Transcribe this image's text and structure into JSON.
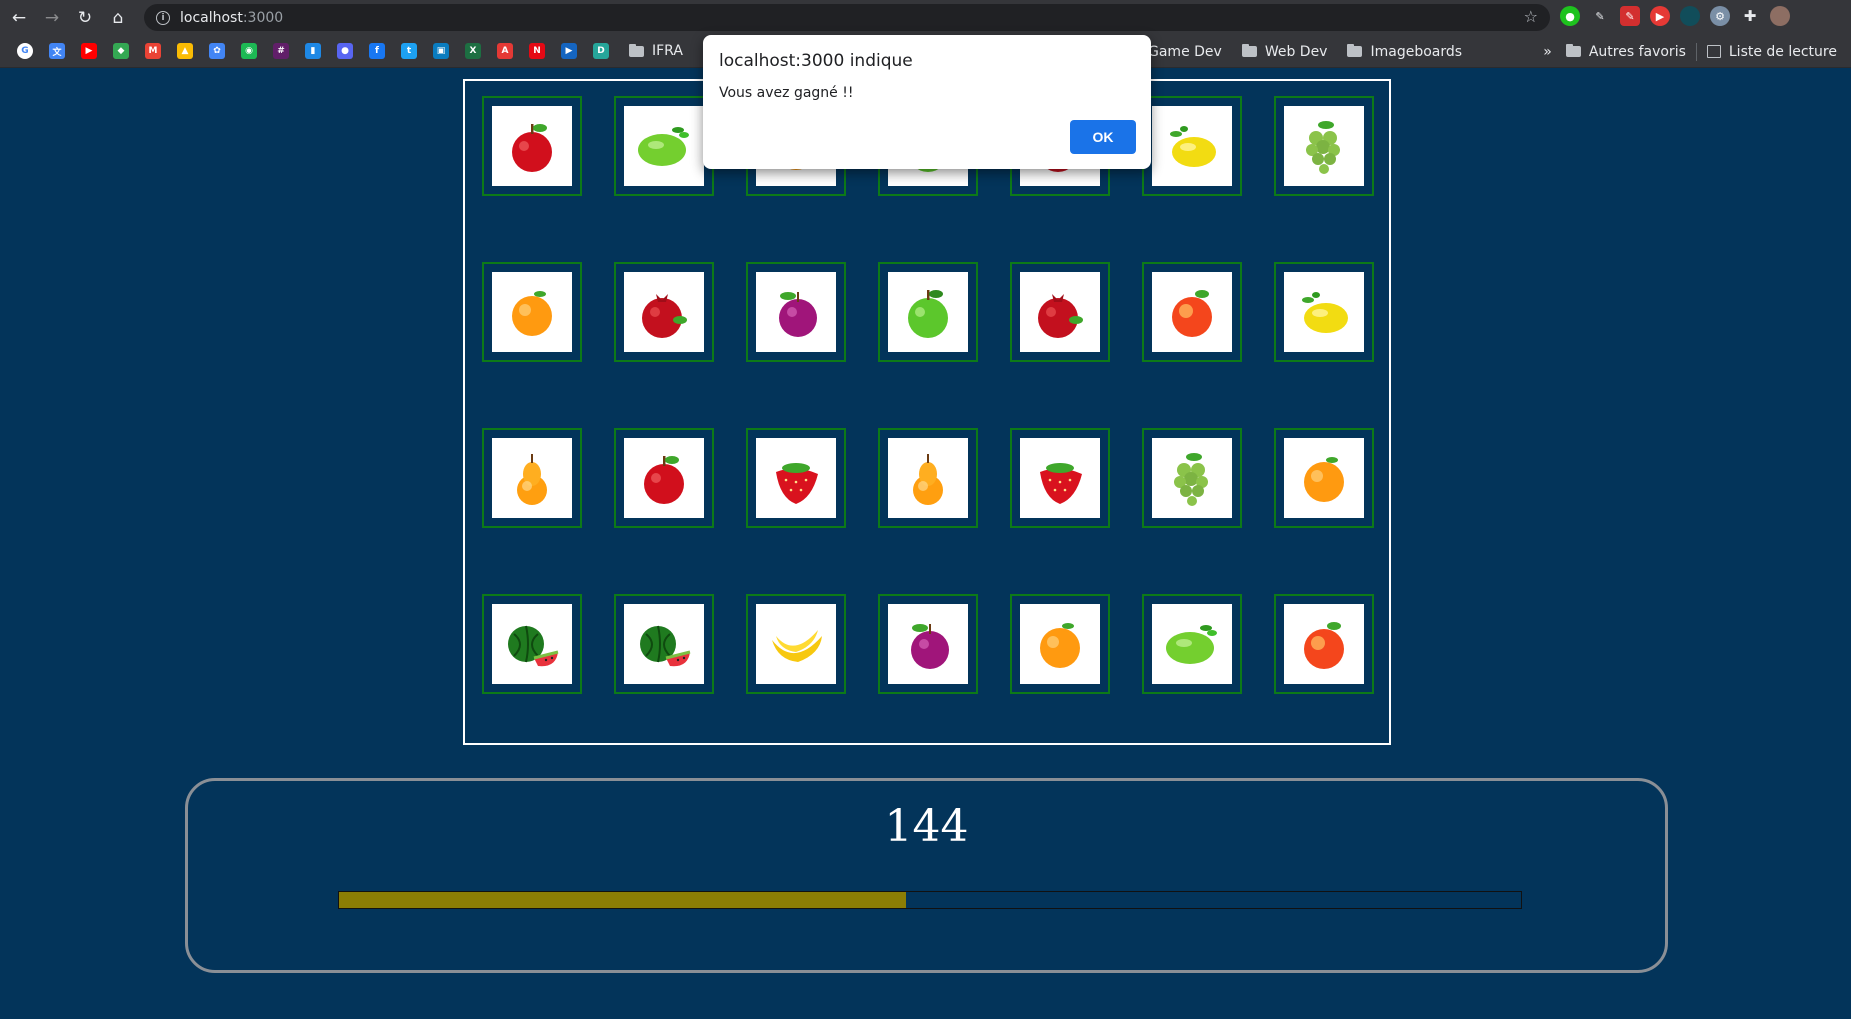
{
  "browser": {
    "url_host": "localhost",
    "url_port": ":3000",
    "bookmarks": [
      {
        "icon": "google-icon",
        "color": "#ffffff",
        "text": "G"
      },
      {
        "icon": "translate-icon",
        "color": "#4285f4",
        "text": "文"
      },
      {
        "icon": "youtube-icon",
        "color": "#ff0000",
        "text": "▶"
      },
      {
        "icon": "maps-icon",
        "color": "#34a853",
        "text": "◆"
      },
      {
        "icon": "gmail-icon",
        "color": "#ea4335",
        "text": "M"
      },
      {
        "icon": "drive-icon",
        "color": "#fbbc04",
        "text": "▲"
      },
      {
        "icon": "photos-icon",
        "color": "#4285f4",
        "text": "✿"
      },
      {
        "icon": "spotify-icon",
        "color": "#1db954",
        "text": "◉"
      },
      {
        "icon": "slack-icon",
        "color": "#611f69",
        "text": "#"
      },
      {
        "icon": "bar-icon",
        "color": "#1e88e5",
        "text": "▮"
      },
      {
        "icon": "discord-icon",
        "color": "#5865f2",
        "text": "●"
      },
      {
        "icon": "facebook-icon",
        "color": "#1877f2",
        "text": "f"
      },
      {
        "icon": "twitter-icon",
        "color": "#1da1f2",
        "text": "t"
      },
      {
        "icon": "monitor-icon",
        "color": "#0a7cbf",
        "text": "▣"
      },
      {
        "icon": "excel-icon",
        "color": "#1d6f42",
        "text": "X"
      },
      {
        "icon": "pdf-icon",
        "color": "#e53935",
        "text": "A"
      },
      {
        "icon": "netflix-icon",
        "color": "#e50914",
        "text": "N"
      },
      {
        "icon": "play-icon",
        "color": "#1565c0",
        "text": "▶"
      },
      {
        "icon": "d-icon",
        "color": "#26a69a",
        "text": "D"
      }
    ],
    "folders_left": [
      "IFRA"
    ],
    "folders_right": [
      "Game Dev",
      "Web Dev",
      "Imageboards"
    ],
    "more": "»",
    "other_favorites": "Autres favoris",
    "reading_list": "Liste de lecture"
  },
  "dialog": {
    "title": "localhost:3000 indique",
    "message": "Vous avez gagné !!",
    "ok_label": "OK"
  },
  "game": {
    "cards": [
      [
        "apple",
        "lime",
        "orange",
        "green-apple",
        "pomegranate",
        "lemon",
        "grapes"
      ],
      [
        "orange",
        "pomegranate",
        "plum",
        "green-apple",
        "pomegranate",
        "peach",
        "lemon"
      ],
      [
        "pear",
        "apple",
        "strawberry",
        "pear",
        "strawberry",
        "grapes",
        "orange"
      ],
      [
        "watermelon",
        "watermelon",
        "banana",
        "plum",
        "orange",
        "lime",
        "peach"
      ]
    ],
    "score": "144",
    "progress": 0.48
  }
}
